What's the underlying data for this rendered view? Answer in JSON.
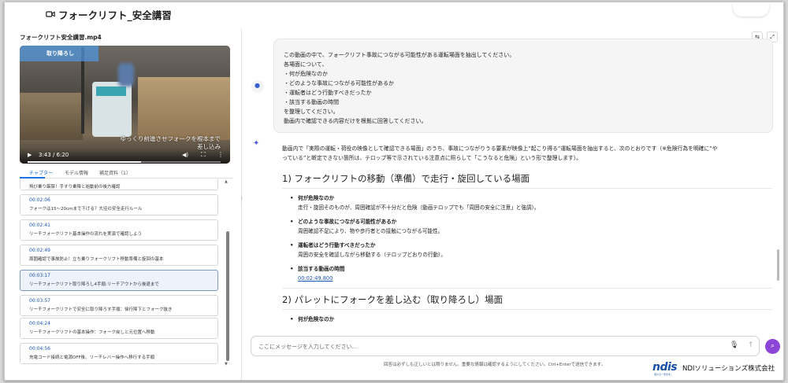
{
  "header": {
    "title": "フォークリフト_安全講習"
  },
  "left": {
    "file_name": "フォークリフト安全講習.mp4",
    "video": {
      "badge": "取り降ろし",
      "subtitle_line1": "ゆっくり前進させフォークを根本まで",
      "subtitle_line2": "差し込み",
      "time": "3:43 / 6:20",
      "progress_fraction": 0.587
    },
    "tabs": [
      {
        "label": "チャプター",
        "active": true
      },
      {
        "label": "モデル情報",
        "active": false
      },
      {
        "label": "補足資料（1）",
        "active": false
      }
    ],
    "chapters": [
      {
        "time": "",
        "desc": "飛び乗り厳禁！手すり乗降と始動前の後方確認"
      },
      {
        "time": "00:02:06",
        "desc": "フォークは15〜20cmまで下げる？大径の安全走行ルール"
      },
      {
        "time": "00:02:41",
        "desc": "リーチフォークリフト基本操作の流れを実演で確認しよう"
      },
      {
        "time": "00:02:49",
        "desc": "周囲確認で事故防止！立ち乗りフォークリフト移動準備と旋回の基本"
      },
      {
        "time": "00:03:17",
        "desc": "リーチフォークリフト取り降ろし4手順:リーチアウトから後退まで"
      },
      {
        "time": "00:03:57",
        "desc": "リーチフォークリフトで安全に取り降ろす手順：徐行降下とフォーク抜き"
      },
      {
        "time": "00:04:24",
        "desc": "リーチフォークリフトの基本操作：フォーク戻しと元位置へ移動"
      },
      {
        "time": "00:04:56",
        "desc": "充電コード接続と電源OFF後、リーチレバー操作へ移行する手順"
      }
    ]
  },
  "prompt": {
    "lines": [
      "この動画の中で、フォークリフト事故につながる可能性がある運転場面を抽出してください。",
      "各場面について、",
      "・何が危険なのか",
      "・どのような事故につながる可能性があるか",
      "・運転者はどう行動すべきだったか",
      "・該当する動画の時間",
      "を整理してください。",
      "動画内で確認できる内容だけを根拠に回答してください。"
    ]
  },
  "response": {
    "intro_line1": "動画内で「実際の運転・荷役の映像として確認できる場面」のうち、事故につながりうる要素が映像上“起こり得る”運転場面を抽出すると、次のとおりです（※危険行為を明確に“や",
    "intro_line2": "っている”と断定できない箇所は、テロップ等で示されている注意点に照らして「こうなると危険」という形で整理します）。",
    "section1": {
      "heading": "1) フォークリフトの移動（準備）で走行・旋回している場面",
      "q1": "何が危険なのか",
      "a1": "走行・旋回そのものが、周囲確認が不十分だと危険（動画テロップでも「周囲の安全に注意」と強調）。",
      "q2": "どのような事故につながる可能性があるか",
      "a2": "周囲確認不足により、物や歩行者との接触につながる可能性。",
      "q3": "運転者はどう行動すべきだったか",
      "a3": "周囲の安全を確認しながら移動する（テロップどおりの行動）。",
      "q4": "該当する動画の時間",
      "link": "00:02:49.800"
    },
    "section2": {
      "heading": "2) パレットにフォークを差し込む（取り降ろし）場面",
      "q1": "何が危険なのか"
    }
  },
  "input": {
    "placeholder": "ここにメッセージを入力してください..."
  },
  "disclaimer": "回答は必ずしも正しいとは限りません。重要な情報は確認するようにしてください。Ctrl+Enterで送信できます。",
  "logo": {
    "mark": "ndis",
    "tagline": "変わる一歩をを。",
    "company": "NDIソリューションズ株式会社"
  },
  "colors": {
    "link": "#1a57b5",
    "accent": "#8d45d8",
    "tab_active": "#1a73e8"
  }
}
